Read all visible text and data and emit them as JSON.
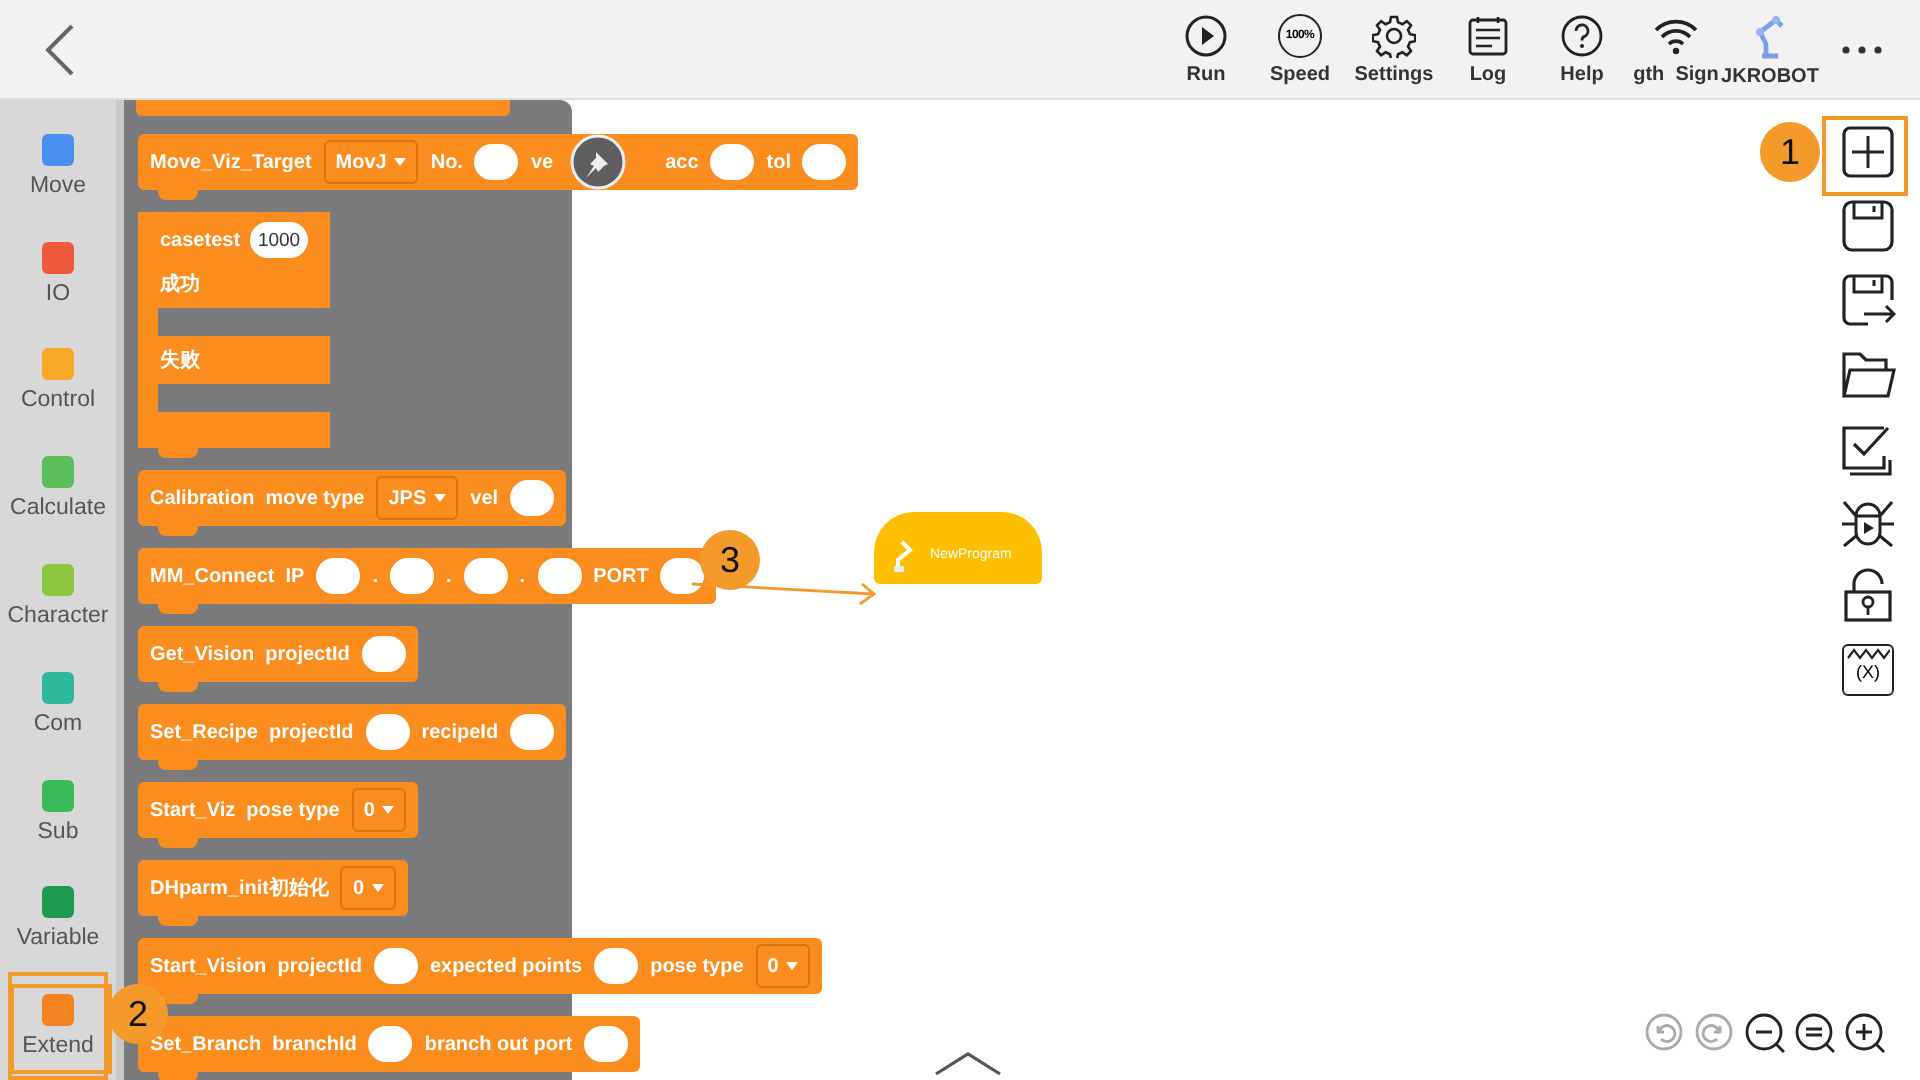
{
  "topbar": {
    "tools": [
      {
        "kind": "run",
        "label": "Run"
      },
      {
        "kind": "speed",
        "label": "Speed",
        "badge": "100%"
      },
      {
        "kind": "settings",
        "label": "Settings"
      },
      {
        "kind": "log",
        "label": "Log"
      },
      {
        "kind": "help",
        "label": "Help"
      },
      {
        "kind": "wifi",
        "label": "gth  Sign"
      },
      {
        "kind": "robot",
        "label": "JKROBOT"
      }
    ]
  },
  "categories": [
    {
      "label": "Move",
      "color": "#4a8ef0",
      "selected": false
    },
    {
      "label": "IO",
      "color": "#ef5a3c",
      "selected": false
    },
    {
      "label": "Control",
      "color": "#f8a826",
      "selected": false
    },
    {
      "label": "Calculate",
      "color": "#5cbf5c",
      "selected": false
    },
    {
      "label": "Character",
      "color": "#8cc63f",
      "selected": false
    },
    {
      "label": "Com",
      "color": "#2fb89a",
      "selected": false
    },
    {
      "label": "Sub",
      "color": "#3cba5a",
      "selected": false
    },
    {
      "label": "Variable",
      "color": "#1e9a50",
      "selected": false
    },
    {
      "label": "Extend",
      "color": "#f58220",
      "selected": true
    }
  ],
  "blocks": [
    {
      "kind": "statement",
      "parts": [
        {
          "kind": "label",
          "text": "Move_Viz_Target"
        },
        {
          "kind": "dropdown",
          "text": "MovJ"
        },
        {
          "kind": "label",
          "text": "No."
        },
        {
          "kind": "input"
        },
        {
          "kind": "label",
          "text": "ve"
        },
        {
          "kind": "gap"
        },
        {
          "kind": "label",
          "text": "acc"
        },
        {
          "kind": "input"
        },
        {
          "kind": "label",
          "text": "tol"
        },
        {
          "kind": "input"
        }
      ]
    },
    {
      "kind": "branch",
      "parts": [
        {
          "kind": "label",
          "text": "casetest"
        },
        {
          "kind": "input",
          "text": "1000"
        }
      ],
      "branches": [
        "成功",
        "失败"
      ]
    },
    {
      "kind": "statement",
      "parts": [
        {
          "kind": "label",
          "text": "Calibration  move type"
        },
        {
          "kind": "dropdown",
          "text": "JPS"
        },
        {
          "kind": "label",
          "text": "vel"
        },
        {
          "kind": "input"
        }
      ]
    },
    {
      "kind": "statement",
      "parts": [
        {
          "kind": "label",
          "text": "MM_Connect  IP"
        },
        {
          "kind": "input"
        },
        {
          "kind": "label",
          "text": "."
        },
        {
          "kind": "input"
        },
        {
          "kind": "label",
          "text": "."
        },
        {
          "kind": "input"
        },
        {
          "kind": "label",
          "text": "."
        },
        {
          "kind": "input"
        },
        {
          "kind": "label",
          "text": "PORT"
        },
        {
          "kind": "input"
        }
      ]
    },
    {
      "kind": "statement",
      "parts": [
        {
          "kind": "label",
          "text": "Get_Vision  projectId"
        },
        {
          "kind": "input"
        }
      ]
    },
    {
      "kind": "statement",
      "parts": [
        {
          "kind": "label",
          "text": "Set_Recipe  projectId"
        },
        {
          "kind": "input"
        },
        {
          "kind": "label",
          "text": "recipeId"
        },
        {
          "kind": "input"
        }
      ]
    },
    {
      "kind": "statement",
      "parts": [
        {
          "kind": "label",
          "text": "Start_Viz  pose type"
        },
        {
          "kind": "dropdown",
          "text": "0"
        }
      ]
    },
    {
      "kind": "statement",
      "parts": [
        {
          "kind": "label",
          "text": "DHparm_init初始化"
        },
        {
          "kind": "dropdown",
          "text": "0"
        }
      ]
    },
    {
      "kind": "statement",
      "parts": [
        {
          "kind": "label",
          "text": "Start_Vision  projectId"
        },
        {
          "kind": "input"
        },
        {
          "kind": "label",
          "text": "expected points"
        },
        {
          "kind": "input"
        },
        {
          "kind": "label",
          "text": "pose type"
        },
        {
          "kind": "dropdown",
          "text": "0"
        }
      ]
    },
    {
      "kind": "statement",
      "parts": [
        {
          "kind": "label",
          "text": "Set_Branch  branchId"
        },
        {
          "kind": "input"
        },
        {
          "kind": "label",
          "text": "branch out port"
        },
        {
          "kind": "input"
        }
      ]
    }
  ],
  "program_block": {
    "label": "NewProgram"
  },
  "side_tools": [
    {
      "kind": "add"
    },
    {
      "kind": "save"
    },
    {
      "kind": "save-as"
    },
    {
      "kind": "open"
    },
    {
      "kind": "check"
    },
    {
      "kind": "debug"
    },
    {
      "kind": "lock"
    },
    {
      "kind": "variables",
      "glyph": "(X)"
    }
  ],
  "zoom_tools": [
    {
      "kind": "undo",
      "disabled": true
    },
    {
      "kind": "redo",
      "disabled": true
    },
    {
      "kind": "zoom-out",
      "disabled": false
    },
    {
      "kind": "reset",
      "disabled": false
    },
    {
      "kind": "zoom-in",
      "disabled": false
    }
  ],
  "annotations": [
    {
      "label": "1"
    },
    {
      "label": "2"
    },
    {
      "label": "3"
    }
  ]
}
